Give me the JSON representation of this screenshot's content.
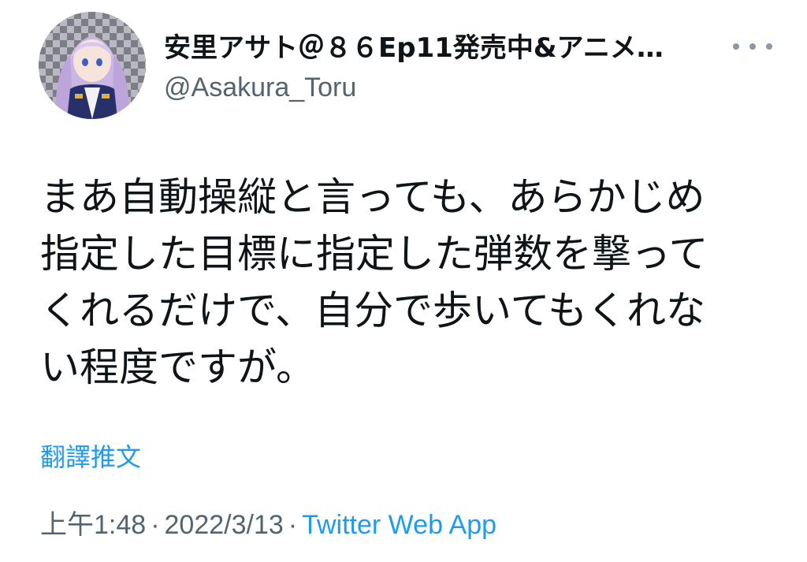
{
  "author": {
    "display_name": "安里アサト＠８６Ep11発売中&アニメ…",
    "handle": "@Asakura_Toru",
    "avatar_icon": "anime-character-avatar"
  },
  "more_menu": {
    "icon": "more-horizontal-icon"
  },
  "tweet": {
    "text_lines": [
      "まあ自動操縦と言っても、あらかじめ",
      "指定した目標に指定した弾数を撃って",
      "くれるだけで、自分で歩いてもくれな",
      "い程度ですが。"
    ],
    "translate_label": "翻譯推文"
  },
  "meta": {
    "time": "上午1:48",
    "separator": "·",
    "date": "2022/3/13",
    "source": "Twitter Web App"
  },
  "colors": {
    "text": "#0f1419",
    "secondary": "#536471",
    "link": "#1d9bf0"
  }
}
